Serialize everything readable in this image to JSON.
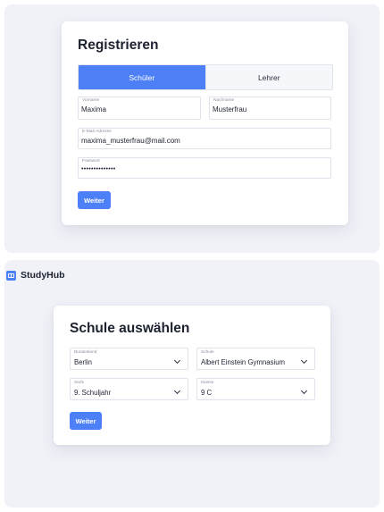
{
  "register": {
    "title": "Registrieren",
    "roles": [
      "Schüler",
      "Lehrer"
    ],
    "active_role": "Schüler",
    "fields": {
      "vorname": {
        "label": "Vorname",
        "value": "Maxima"
      },
      "nachname": {
        "label": "Nachname",
        "value": "Musterfrau"
      },
      "email": {
        "label": "E-Mail-Adresse",
        "value": "maxima_musterfrau@mail.com"
      },
      "password": {
        "label": "Passwort",
        "value": "••••••••••••••"
      }
    },
    "next_label": "Weiter"
  },
  "brand": {
    "name": "StudyHub",
    "icon": "book-icon"
  },
  "school": {
    "title": "Schule auswählen",
    "selects": {
      "bundesland": {
        "label": "Bundesland",
        "value": "Berlin"
      },
      "schule": {
        "label": "Schule",
        "value": "Albert Einstein Gymnasium"
      },
      "stufe": {
        "label": "Stufe",
        "value": "9. Schuljahr"
      },
      "klasse": {
        "label": "Klasse",
        "value": "9 C"
      }
    },
    "next_label": "Weiter"
  },
  "colors": {
    "accent": "#4d7ff7",
    "panel_background": "#f1f2f8",
    "card_background": "#ffffff",
    "text": "#1d2230"
  }
}
